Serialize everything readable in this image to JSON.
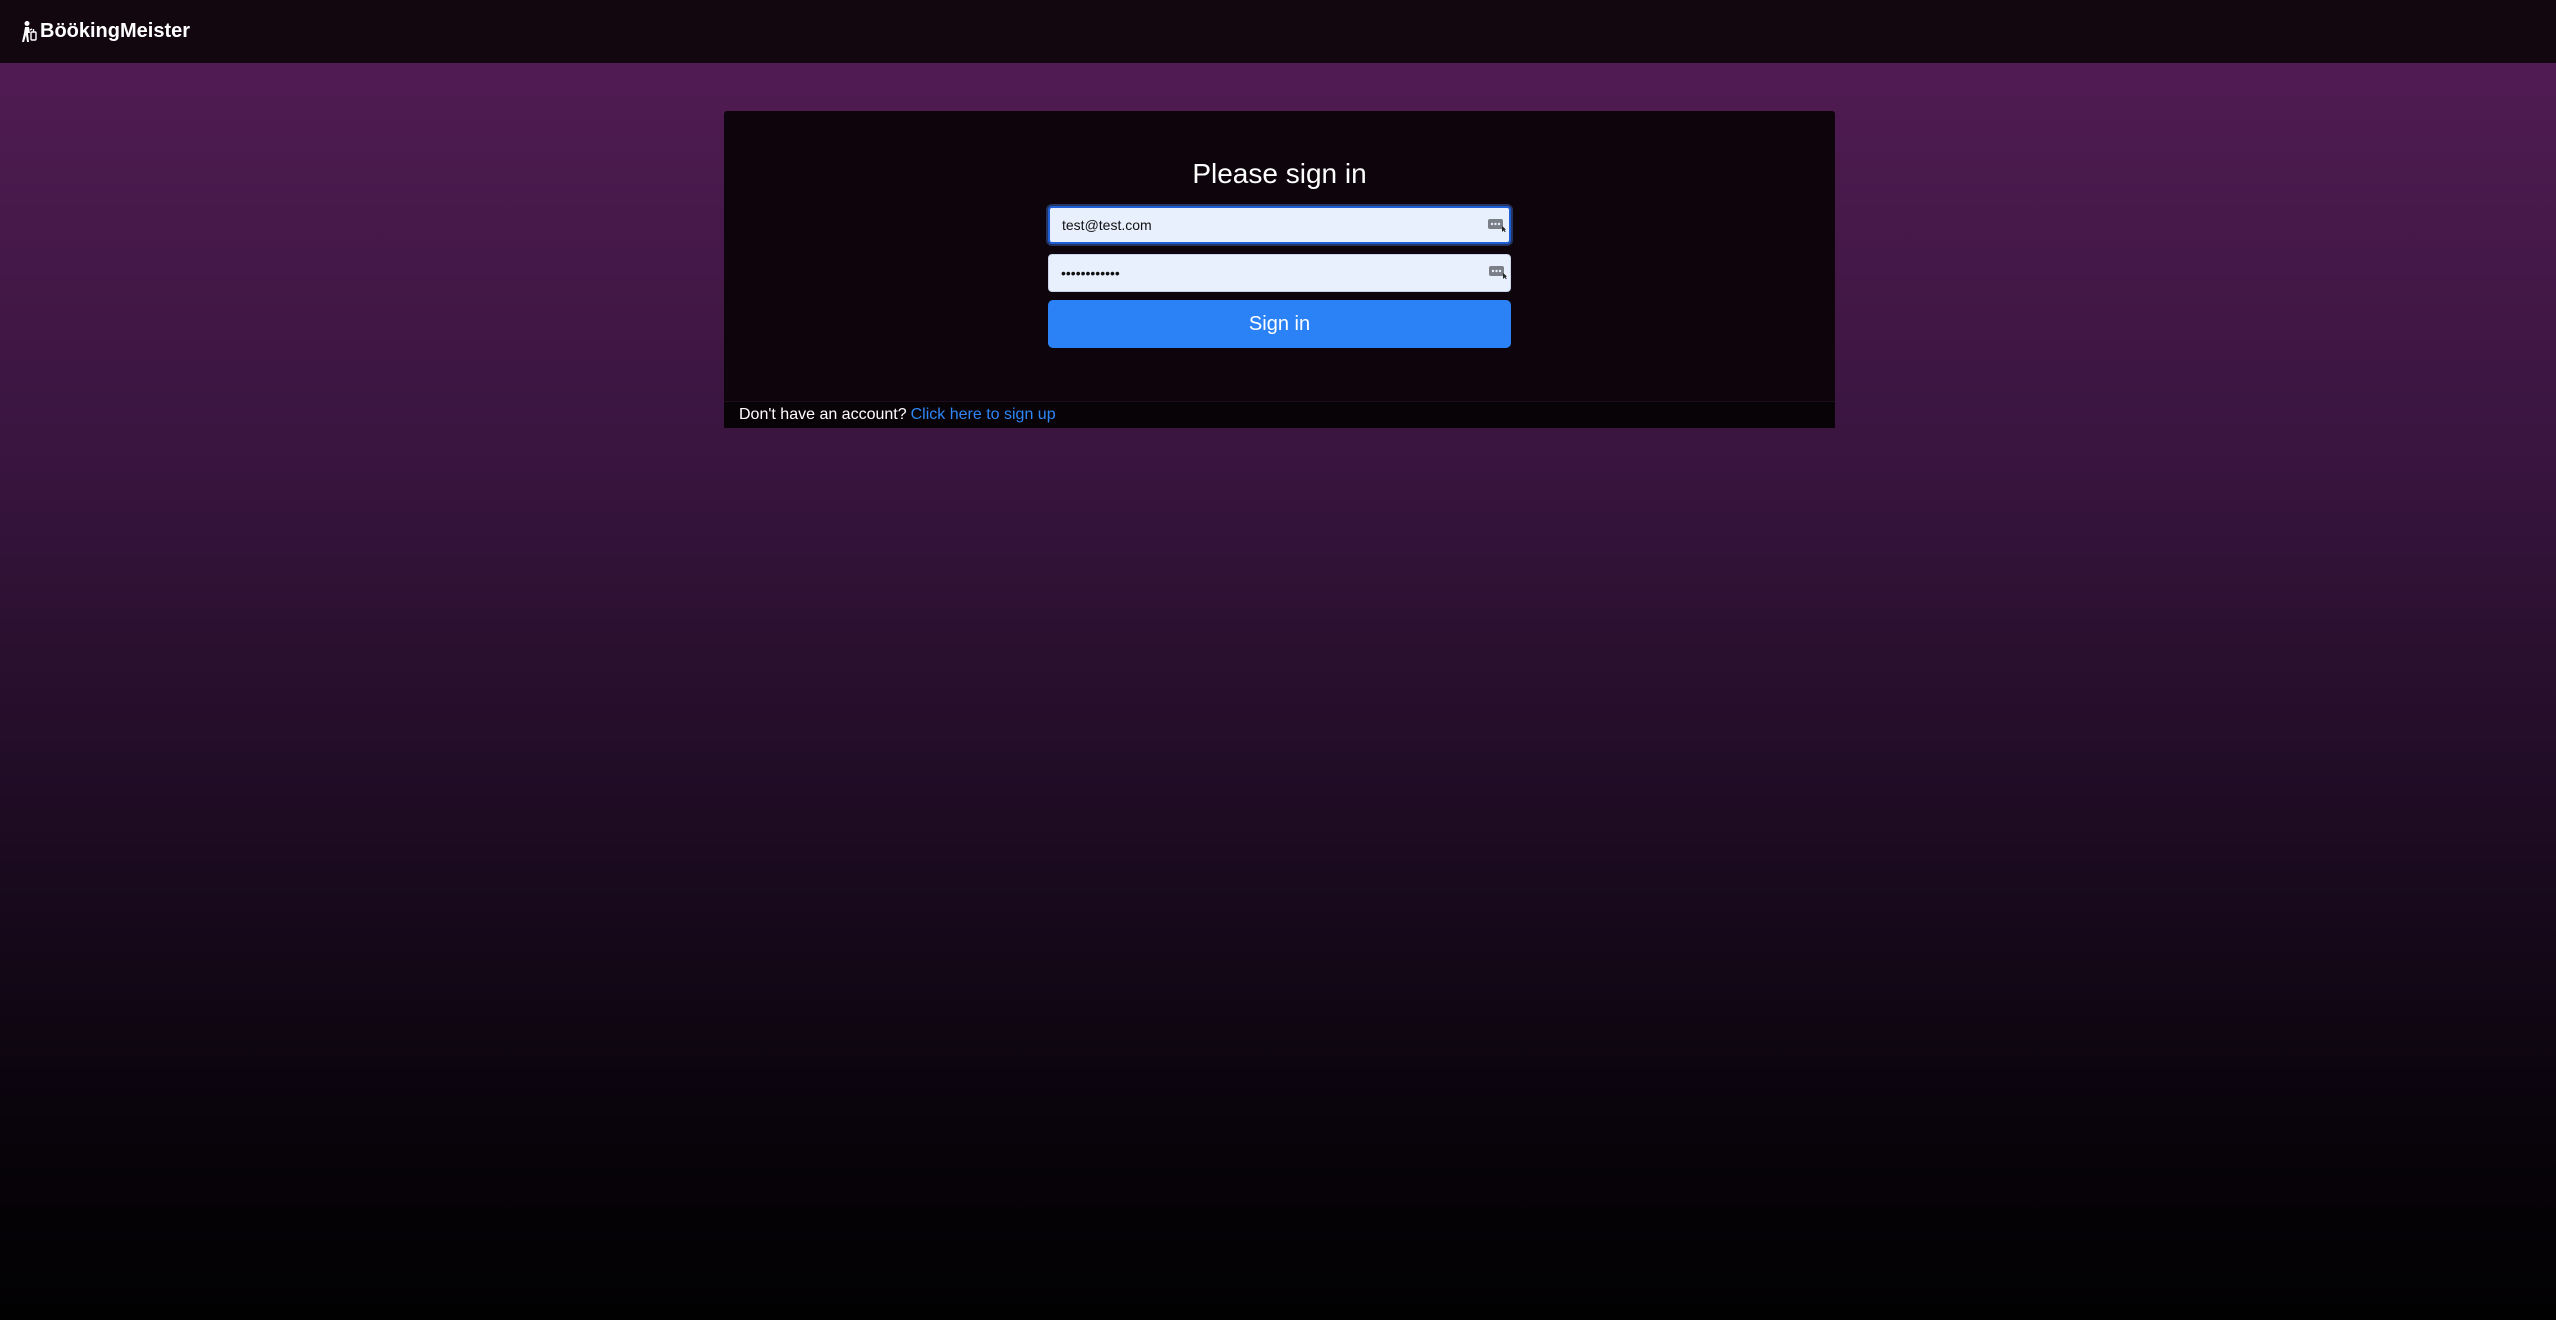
{
  "navbar": {
    "brand_label": "BöökingMeister",
    "brand_icon": "person-walking-luggage-icon"
  },
  "login": {
    "title": "Please sign in",
    "email_value": "test@test.com",
    "password_value": "••••••••••••",
    "submit_label": "Sign in",
    "footer_text": "Don't have an account?",
    "signup_link_label": "Click here to sign up"
  },
  "colors": {
    "accent": "#2b82f6",
    "link": "#2f86f7",
    "navbar_bg": "#12060f",
    "card_bg": "#0d040c",
    "input_bg": "#e8f0fe",
    "background_top": "#551c58",
    "background_bottom": "#020102"
  }
}
